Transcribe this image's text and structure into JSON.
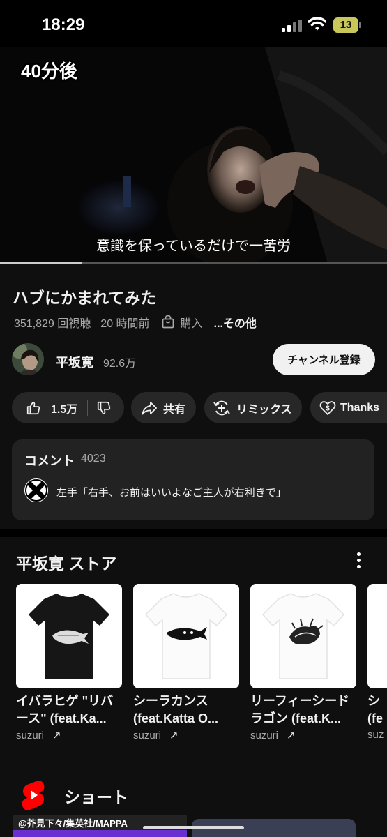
{
  "status_bar": {
    "time": "18:29",
    "battery": "13"
  },
  "video": {
    "overlay_text": "40分後",
    "subtitle": "意識を保っているだけで一苦労",
    "progress": 0.21
  },
  "title": "ハブにかまれてみた",
  "meta": {
    "views": "351,829 回視聴",
    "time": "20 時間前",
    "buy": "購入",
    "more": "...その他"
  },
  "channel": {
    "name": "平坂寛",
    "subscribers": "92.6万",
    "subscribe_label": "チャンネル登録"
  },
  "actions": {
    "likes": "1.5万",
    "share": "共有",
    "remix": "リミックス",
    "thanks": "Thanks"
  },
  "comments": {
    "title": "コメント",
    "count": "4023",
    "top_comment": "左手「右手、お前はいいよなご主人が右利きで」"
  },
  "store": {
    "title": "平坂寛 ストア",
    "products": [
      {
        "line1": "イバラヒゲ \"リバ",
        "line2": "ース\" (feat.Ka...",
        "vendor": "suzuri",
        "shirt_color": "#161616"
      },
      {
        "line1": "シーラカンス",
        "line2": "(feat.Katta O...",
        "vendor": "suzuri",
        "shirt_color": "#fbfbfb"
      },
      {
        "line1": "リーフィーシード",
        "line2": "ラゴン (feat.K...",
        "vendor": "suzuri",
        "shirt_color": "#fbfbfb"
      },
      {
        "line1": "シ",
        "line2": "(fe",
        "vendor": "suz",
        "shirt_color": "#fbfbfb"
      }
    ]
  },
  "shorts": {
    "title": "ショート",
    "credit": "@芥見下々/集英社/MAPPA"
  },
  "colors": {
    "background": "#0f0f0f",
    "surface": "#272727",
    "shorts_red": "#ff0000"
  }
}
